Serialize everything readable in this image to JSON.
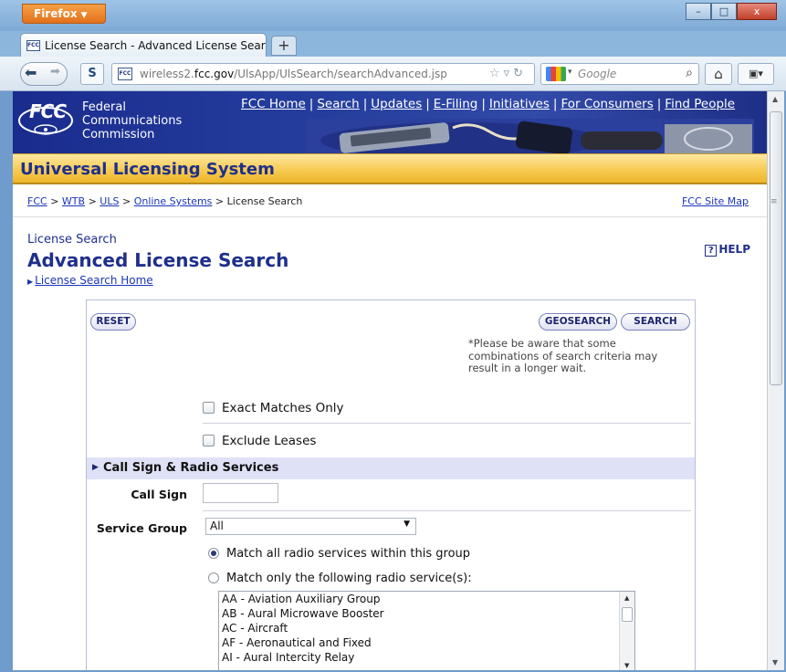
{
  "browser": {
    "menu_button": "Firefox",
    "tab_title": "License Search - Advanced License Search",
    "url_prefix": "wireless2.",
    "url_domain": "fcc.gov",
    "url_path": "/UlsApp/UlsSearch/searchAdvanced.jsp",
    "search_placeholder": "Google",
    "minimize": "–",
    "maximize": "□",
    "close": "x"
  },
  "fcc_header": {
    "logo": "FCC",
    "org_lines": [
      "Federal",
      "Communications",
      "Commission"
    ],
    "links": [
      "FCC Home",
      "Search",
      "Updates",
      "E-Filing",
      "Initiatives",
      "For Consumers",
      "Find People"
    ],
    "system_title": "Universal Licensing System"
  },
  "breadcrumb": {
    "items": [
      "FCC",
      "WTB",
      "ULS",
      "Online Systems"
    ],
    "current": "License Search",
    "site_map": "FCC Site Map"
  },
  "page": {
    "subtitle": "License Search",
    "title": "Advanced License Search",
    "home_link": "License Search Home",
    "help": "HELP"
  },
  "form": {
    "reset_label": "RESET",
    "geosearch_label": "GEOSEARCH",
    "search_label": "SEARCH",
    "note": "*Please be aware that some combinations of search criteria may result in a longer wait.",
    "exact_matches": "Exact Matches Only",
    "exclude_leases": "Exclude Leases",
    "section_title": "Call Sign & Radio Services",
    "call_sign_label": "Call Sign",
    "call_sign_value": "",
    "service_group_label": "Service Group",
    "service_group_value": "All",
    "radio_all": "Match all radio services within this group",
    "radio_only": "Match only the following radio service(s):",
    "services": [
      "AA - Aviation Auxiliary Group",
      "AB - Aural Microwave Booster",
      "AC - Aircraft",
      "AF - Aeronautical and Fixed",
      "AI - Aural Intercity Relay"
    ]
  },
  "colors": {
    "fcc_navy": "#1f2f8c",
    "link_blue": "#1a35b6",
    "uls_gold": "#f6c94d",
    "section_bg": "#dfe2f6"
  }
}
